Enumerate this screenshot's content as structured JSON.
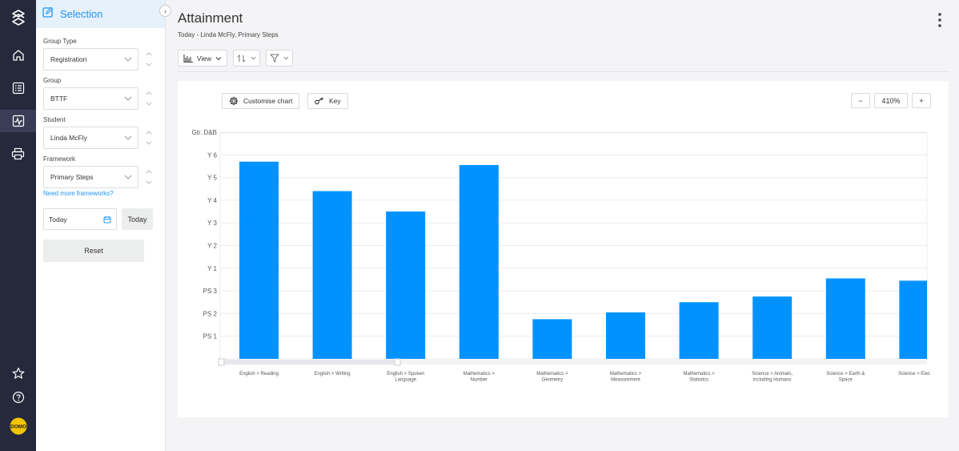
{
  "rail": {
    "items": [
      "logo-icon",
      "home-icon",
      "list-icon",
      "activity-icon",
      "print-icon"
    ],
    "bottom": [
      "star-icon",
      "help-icon",
      "avatar"
    ],
    "avatar_text": "DOMO"
  },
  "panel": {
    "title": "Selection",
    "group_type_label": "Group Type",
    "group_type_value": "Registration",
    "group_label": "Group",
    "group_value": "BTTF",
    "student_label": "Student",
    "student_value": "Linda McFly",
    "framework_label": "Framework",
    "framework_value": "Primary Steps",
    "more_frameworks_link": "Need more frameworks?",
    "date_value": "Today",
    "today_button": "Today",
    "reset_button": "Reset"
  },
  "main": {
    "title": "Attainment",
    "subtitle": "Today - Linda McFly, Primary Steps",
    "view_button": "View",
    "customise_button": "Customise chart",
    "key_button": "Key",
    "zoom": "410%",
    "zoom_out": "−",
    "zoom_in": "+"
  },
  "colors": {
    "accent": "#2196f3",
    "bar": "#0093ff",
    "rail": "#26283c"
  },
  "chart_data": {
    "type": "bar",
    "y_levels": [
      "PS 1",
      "PS 2",
      "PS 3",
      "Y 1",
      "Y 2",
      "Y 3",
      "Y 4",
      "Y 5",
      "Y 6",
      "Gtr. D&B"
    ],
    "categories": [
      "English > Reading",
      "English > Writing",
      "English > Spoken Language",
      "Mathematics > Number",
      "Mathematics > Geometry",
      "Mathematics > Measurement",
      "Mathematics > Statistics",
      "Science > Animals, including Humans",
      "Science > Earth & Space",
      "Science > Elec"
    ],
    "category_lines": [
      [
        "English > Reading"
      ],
      [
        "English > Writing"
      ],
      [
        "English > Spoken",
        "Language"
      ],
      [
        "Mathematics >",
        "Number"
      ],
      [
        "Mathematics >",
        "Geometry"
      ],
      [
        "Mathematics >",
        "Measurement"
      ],
      [
        "Mathematics >",
        "Statistics"
      ],
      [
        "Science > Animals,",
        "including Humans"
      ],
      [
        "Science > Earth &",
        "Space"
      ],
      [
        "Science > Elec"
      ]
    ],
    "values": [
      8.7,
      7.4,
      6.5,
      8.55,
      1.75,
      2.05,
      2.5,
      2.75,
      3.55,
      3.45
    ],
    "ylim": [
      0,
      10
    ],
    "grid": true,
    "legend": "none"
  }
}
